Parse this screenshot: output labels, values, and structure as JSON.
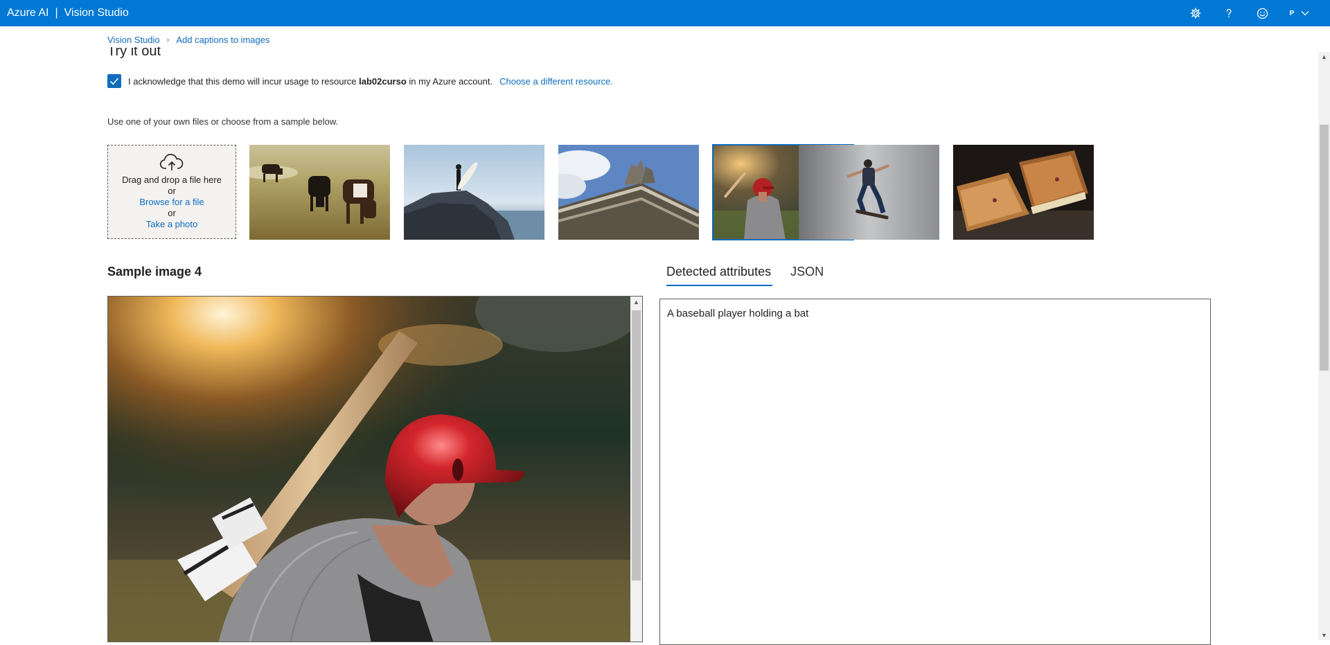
{
  "header": {
    "brand": "Azure AI",
    "separator": "|",
    "app_name": "Vision Studio",
    "avatar_initial": "P",
    "brand_color": "#0078d4"
  },
  "breadcrumb": {
    "root": "Vision Studio",
    "current": "Add captions to images"
  },
  "section_title": "Try it out",
  "acknowledge": {
    "checked": true,
    "text_before": "I acknowledge that this demo will incur usage to resource",
    "resource": "lab02curso",
    "text_after": "in my Azure account.",
    "link": "Choose a different resource."
  },
  "upload": {
    "instruction": "Use one of your own files or choose from a sample below.",
    "drag_text": "Drag and drop a file here",
    "or1": "or",
    "browse_link": "Browse for a file",
    "or2": "or",
    "photo_link": "Take a photo"
  },
  "samples": [
    {
      "icon": "cows-grazing-image"
    },
    {
      "icon": "surfer-on-rock-image"
    },
    {
      "icon": "building-statues-image"
    },
    {
      "icon": "baseball-player-image",
      "selected": true
    },
    {
      "icon": "skateboarder-image"
    },
    {
      "icon": "grilled-sandwich-image"
    }
  ],
  "preview": {
    "title": "Sample image 4"
  },
  "tabs": [
    {
      "label": "Detected attributes",
      "active": true
    },
    {
      "label": "JSON",
      "active": false
    }
  ],
  "result": {
    "caption": "A baseball player holding a bat"
  }
}
